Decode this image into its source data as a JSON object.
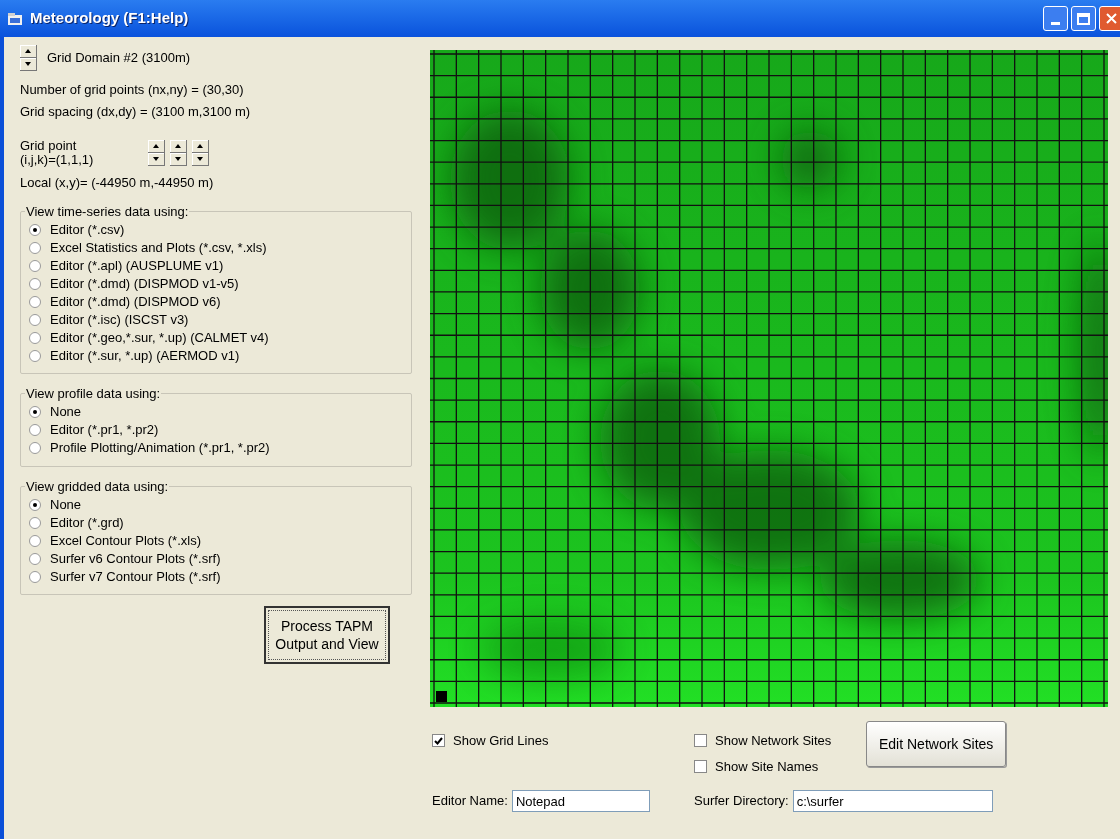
{
  "window": {
    "title": "Meteorology (F1:Help)"
  },
  "domain": {
    "label": "Grid Domain #2 (3100m)"
  },
  "info_lines": [
    "Number of grid points (nx,ny) = (30,30)",
    "Grid spacing (dx,dy) = (3100 m,3100 m)"
  ],
  "grid_point": {
    "label_lines": [
      "Grid point",
      "(i,j,k)=(1,1,1)"
    ],
    "local": "Local (x,y)= (-44950 m,-44950 m)"
  },
  "groups": [
    {
      "title": "View time-series data using:",
      "options": [
        {
          "label": "Editor (*.csv)",
          "selected": true
        },
        {
          "label": "Excel Statistics and Plots (*.csv, *.xls)",
          "selected": false
        },
        {
          "label": "Editor (*.apl) (AUSPLUME v1)",
          "selected": false
        },
        {
          "label": "Editor (*.dmd) (DISPMOD v1-v5)",
          "selected": false
        },
        {
          "label": "Editor (*.dmd) (DISPMOD v6)",
          "selected": false
        },
        {
          "label": "Editor (*.isc) (ISCST v3)",
          "selected": false
        },
        {
          "label": "Editor (*.geo,*.sur, *.up) (CALMET v4)",
          "selected": false
        },
        {
          "label": "Editor (*.sur, *.up) (AERMOD v1)",
          "selected": false
        }
      ]
    },
    {
      "title": "View profile data using:",
      "options": [
        {
          "label": "None",
          "selected": true
        },
        {
          "label": "Editor (*.pr1, *.pr2)",
          "selected": false
        },
        {
          "label": "Profile Plotting/Animation (*.pr1, *.pr2)",
          "selected": false
        }
      ]
    },
    {
      "title": "View gridded data using:",
      "options": [
        {
          "label": "None",
          "selected": true
        },
        {
          "label": "Editor (*.grd)",
          "selected": false
        },
        {
          "label": "Excel Contour Plots (*.xls)",
          "selected": false
        },
        {
          "label": "Surfer v6 Contour Plots (*.srf)",
          "selected": false
        },
        {
          "label": "Surfer v7 Contour Plots (*.srf)",
          "selected": false
        }
      ]
    }
  ],
  "process_button": "Process TAPM Output and View",
  "show_grid_lines": {
    "label": "Show Grid Lines",
    "checked": true
  },
  "site_options": [
    {
      "label": "Show Network Sites",
      "checked": false
    },
    {
      "label": "Show Site Names",
      "checked": false
    }
  ],
  "edit_sites_button": "Edit Network Sites",
  "editor_name": {
    "label": "Editor Name:",
    "value": "Notepad"
  },
  "surfer_directory": {
    "label": "Surfer Directory:",
    "value": "c:\\surfer"
  }
}
